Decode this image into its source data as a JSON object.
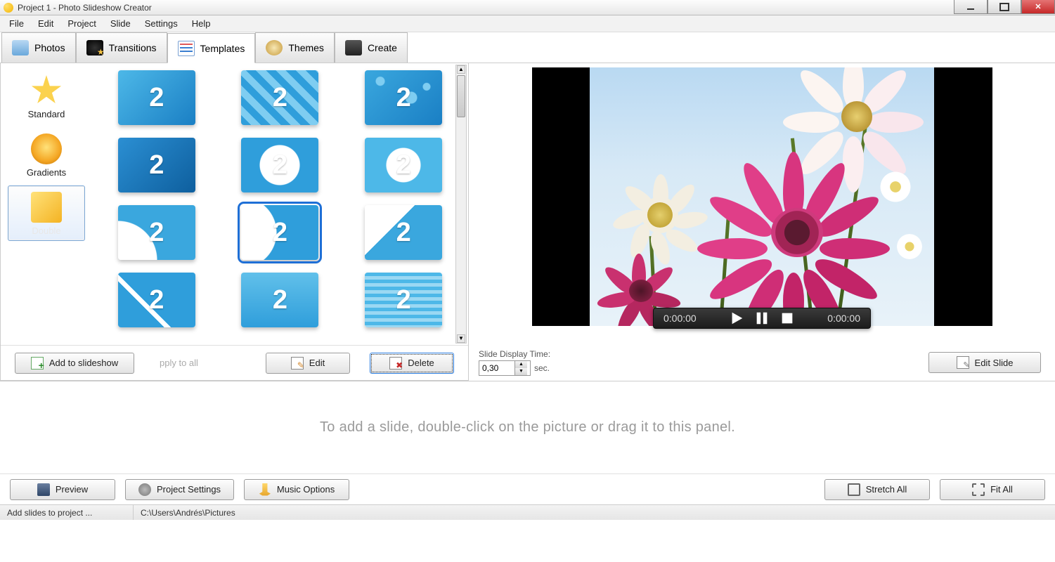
{
  "window": {
    "title": "Project 1 - Photo Slideshow Creator"
  },
  "menu": {
    "items": [
      "File",
      "Edit",
      "Project",
      "Slide",
      "Settings",
      "Help"
    ]
  },
  "tabs": {
    "items": [
      {
        "label": "Photos",
        "icon": "photos-icon"
      },
      {
        "label": "Transitions",
        "icon": "transitions-icon"
      },
      {
        "label": "Templates",
        "icon": "templates-icon"
      },
      {
        "label": "Themes",
        "icon": "themes-icon"
      },
      {
        "label": "Create",
        "icon": "create-icon"
      }
    ],
    "active_index": 2
  },
  "categories": {
    "items": [
      {
        "label": "Standard",
        "icon": "star-icon"
      },
      {
        "label": "Gradients",
        "icon": "gradient-sphere-icon"
      },
      {
        "label": "Double",
        "icon": "pinned-note-icon"
      }
    ],
    "selected_index": 2
  },
  "templates": {
    "glyph": "2",
    "count": 12,
    "selected_index": 7
  },
  "left_buttons": {
    "add": "Add to slideshow",
    "apply_ghost": "pply to all",
    "edit": "Edit",
    "delete": "Delete"
  },
  "preview": {
    "time_elapsed": "0:00:00",
    "time_total": "0:00:00"
  },
  "slide_display": {
    "label": "Slide Display Time:",
    "value": "0,30",
    "unit": "sec."
  },
  "edit_slide_label": "Edit Slide",
  "timeline": {
    "hint": "To add a slide, double-click on the picture or drag it to this panel.",
    "buttons": {
      "preview": "Preview",
      "project_settings": "Project Settings",
      "music_options": "Music Options",
      "stretch_all": "Stretch All",
      "fit_all": "Fit All"
    }
  },
  "statusbar": {
    "hint": "Add slides to project ...",
    "path": "C:\\Users\\Andrés\\Pictures"
  }
}
